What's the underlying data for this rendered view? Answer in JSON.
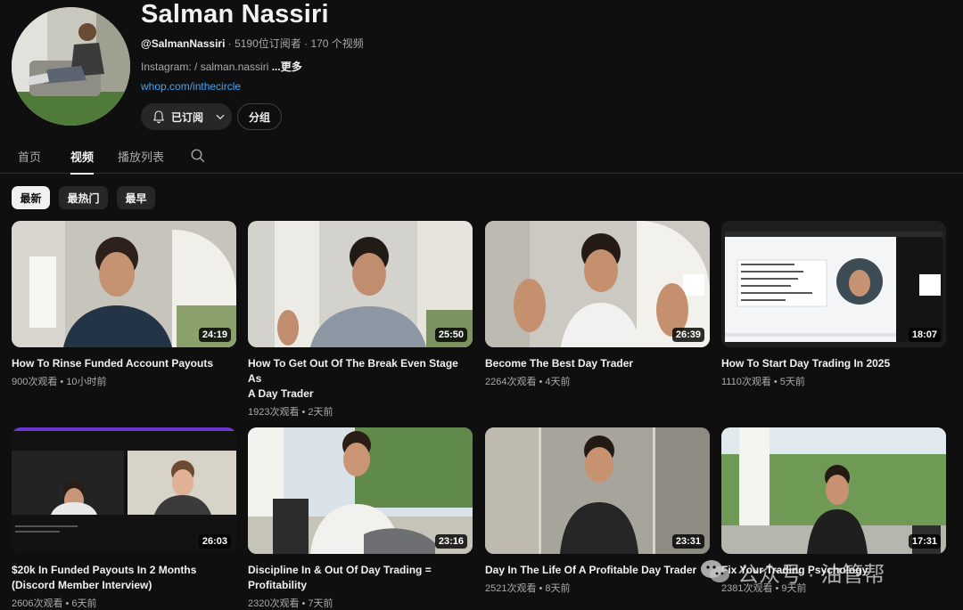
{
  "channel": {
    "name": "Salman Nassiri",
    "handle": "@SalmanNassiri",
    "stats": " · 5190位订阅者 · 170 个视频",
    "desc_prefix": "Instagram:   / salman.nassiri ",
    "desc_more": "...更多",
    "link": "whop.com/inthecircle",
    "subscribed_label": "已订阅",
    "group_label": "分组"
  },
  "tabs": [
    {
      "label": "首页"
    },
    {
      "label": "视频"
    },
    {
      "label": "播放列表"
    }
  ],
  "filters": [
    {
      "label": "最新"
    },
    {
      "label": "最热门"
    },
    {
      "label": "最早"
    }
  ],
  "videos": [
    {
      "title_lines": [
        "How To Rinse Funded Account Payouts"
      ],
      "meta": "900次观看 • 10小时前",
      "duration": "24:19"
    },
    {
      "title_lines": [
        "How To Get Out Of The Break Even Stage As",
        "A Day Trader"
      ],
      "meta": "1923次观看 • 2天前",
      "duration": "25:50"
    },
    {
      "title_lines": [
        "Become The Best Day Trader"
      ],
      "meta": "2264次观看 • 4天前",
      "duration": "26:39"
    },
    {
      "title_lines": [
        "How To Start Day Trading In 2025"
      ],
      "meta": "1110次观看 • 5天前",
      "duration": "18:07"
    },
    {
      "title_lines": [
        "$20k In Funded Payouts In 2 Months",
        "(Discord Member Interview)"
      ],
      "meta": "2606次观看 • 6天前",
      "duration": "26:03"
    },
    {
      "title_lines": [
        "Discipline In & Out Of Day Trading =",
        "Profitability"
      ],
      "meta": "2320次观看 • 7天前",
      "duration": "23:16"
    },
    {
      "title_lines": [
        "Day In The Life Of A Profitable Day Trader"
      ],
      "meta": "2521次观看 • 8天前",
      "duration": "23:31"
    },
    {
      "title_lines": [
        "Fix Your Trading Psychology"
      ],
      "meta": "2381次观看 • 9天前",
      "duration": "17:31"
    }
  ],
  "watermark": {
    "text": "公众号 · 油管帮"
  }
}
